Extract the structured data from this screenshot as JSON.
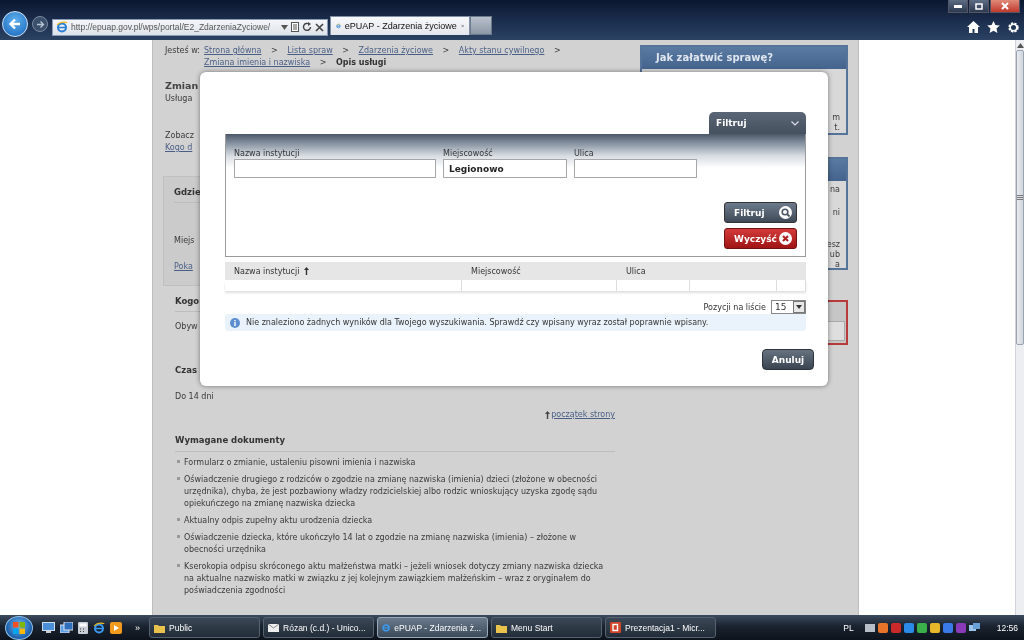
{
  "browser": {
    "url": "http://epuap.gov.pl/wps/portal/E2_ZdarzeniaZyciowe/",
    "tabs": [
      {
        "title": "ePUAP - Zdarzenia życiowe",
        "selected": true
      }
    ]
  },
  "breadcrumb": {
    "label": "Jesteś w:",
    "items": [
      {
        "text": "Strona główna",
        "kind": "link"
      },
      {
        "text": ">",
        "kind": "separator"
      },
      {
        "text": "Lista spraw",
        "kind": "link"
      },
      {
        "text": ">",
        "kind": "separator"
      },
      {
        "text": "Zdarzenia życiowe",
        "kind": "link"
      },
      {
        "text": ">",
        "kind": "separator"
      },
      {
        "text": "Akty stanu cywilnego",
        "kind": "link"
      },
      {
        "text": ">",
        "kind": "separator"
      },
      {
        "text": "Zmiana imienia i nazwiska",
        "kind": "link"
      },
      {
        "text": ">",
        "kind": "separator"
      },
      {
        "text": "Opis usługi",
        "kind": "current"
      }
    ]
  },
  "page": {
    "title": "Zmian",
    "subtitle": "Usługa",
    "see_also": "Zobacz",
    "see_also_link": "Kogo d",
    "where": {
      "heading": "Gdzie",
      "text": "Miejs",
      "link": "Poka"
    },
    "who": {
      "heading": "Kogo",
      "text": "Obyw"
    },
    "time": {
      "heading": "Czas",
      "text": "Do 14 dni"
    },
    "back_to_top": "początek strony",
    "documents": {
      "heading": "Wymagane dokumenty",
      "items": [
        "Formularz o zmianie, ustaleniu pisowni imienia i nazwiska",
        "Oświadczenie drugiego z rodziców o zgodzie na zmianę nazwiska (imienia) dzieci (złożone w obecności urzędnika), chyba, że jest pozbawiony władzy rodzicielskiej albo rodzic wnioskujący uzyska zgodę sądu opiekuńczego na zmianę nazwiska dziecka",
        "Aktualny odpis zupełny aktu urodzenia dziecka",
        "Oświadczenie dziecka, które ukończyło 14 lat o zgodzie na zmianę nazwiska (imienia) – złożone w obecności urzędnika",
        "Kserokopia odpisu skróconego aktu małżeństwa matki – jeżeli wniosek dotyczy zmiany nazwiska dziecka na aktualne nazwisko matki w związku z jej kolejnym zawiązkiem małżeńskim – wraz z oryginałem do poświadczenia zgodności"
      ]
    }
  },
  "sidebar": [
    {
      "kind": "info",
      "title": "Jak załatwić sprawę?",
      "fragments": [
        "m",
        "t."
      ]
    },
    {
      "kind": "info",
      "fragments": [
        "na",
        "ni",
        "esz",
        "ub",
        "a"
      ]
    },
    {
      "kind": "alert"
    }
  ],
  "dialog": {
    "filter_tab": {
      "label": "Filtruj",
      "expanded": true
    },
    "fields": [
      {
        "label": "Nazwa instytucji"
      },
      {
        "label": "Miejscowość",
        "value": "Legionowo"
      },
      {
        "label": "Ulica"
      }
    ],
    "buttons": [
      {
        "label": "Filtruj",
        "kind": "filter"
      },
      {
        "label": "Wyczyść",
        "kind": "clear"
      }
    ],
    "table": {
      "columns": [
        {
          "label": "Nazwa instytucji",
          "sorted": true
        },
        {
          "label": "Miejscowość",
          "sorted": false
        },
        {
          "label": "Ulica",
          "sorted": false
        }
      ]
    },
    "page_size": {
      "label": "Pozycji na liście",
      "value": "15"
    },
    "message": "Nie znaleziono żadnych wyników dla Twojego wyszukiwania. Sprawdź czy wpisany wyraz został poprawnie wpisany.",
    "cancel": "Anuluj"
  },
  "taskbar": {
    "more": "»",
    "tasks": [
      {
        "title": "Public",
        "kind": "folder",
        "selected": false
      },
      {
        "title": "Rózan (c.d.) - Unico...",
        "kind": "mail",
        "selected": false
      },
      {
        "title": "ePUAP - Zdarzenia ż...",
        "kind": "browser",
        "selected": true
      },
      {
        "title": "Menu Start",
        "kind": "folder",
        "selected": false
      },
      {
        "title": "Prezentacja1 - Micr...",
        "kind": "slides",
        "selected": false
      }
    ],
    "language": "PL",
    "clock": "12:56"
  }
}
